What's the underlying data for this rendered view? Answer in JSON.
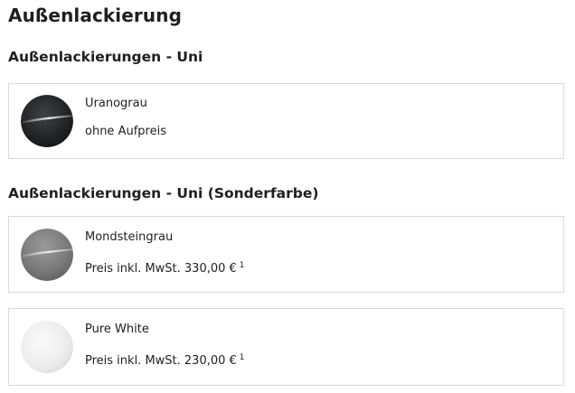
{
  "page": {
    "title": "Außenlackierung"
  },
  "sections": [
    {
      "title": "Außenlackierungen - Uni",
      "items": [
        {
          "name": "Uranograu",
          "price": "ohne Aufpreis",
          "footnote": "",
          "swatch_icon": "paint-swatch-dark-grey",
          "swatch_color": "#2b2d2f"
        }
      ]
    },
    {
      "title": "Außenlackierungen - Uni (Sonderfarbe)",
      "items": [
        {
          "name": "Mondsteingrau",
          "price": "Preis inkl. MwSt. 330,00 €",
          "footnote": "1",
          "swatch_icon": "paint-swatch-mid-grey",
          "swatch_color": "#7c7c7c"
        },
        {
          "name": "Pure White",
          "price": "Preis inkl. MwSt. 230,00 €",
          "footnote": "1",
          "swatch_icon": "paint-swatch-white",
          "swatch_color": "#efefef"
        }
      ]
    }
  ]
}
